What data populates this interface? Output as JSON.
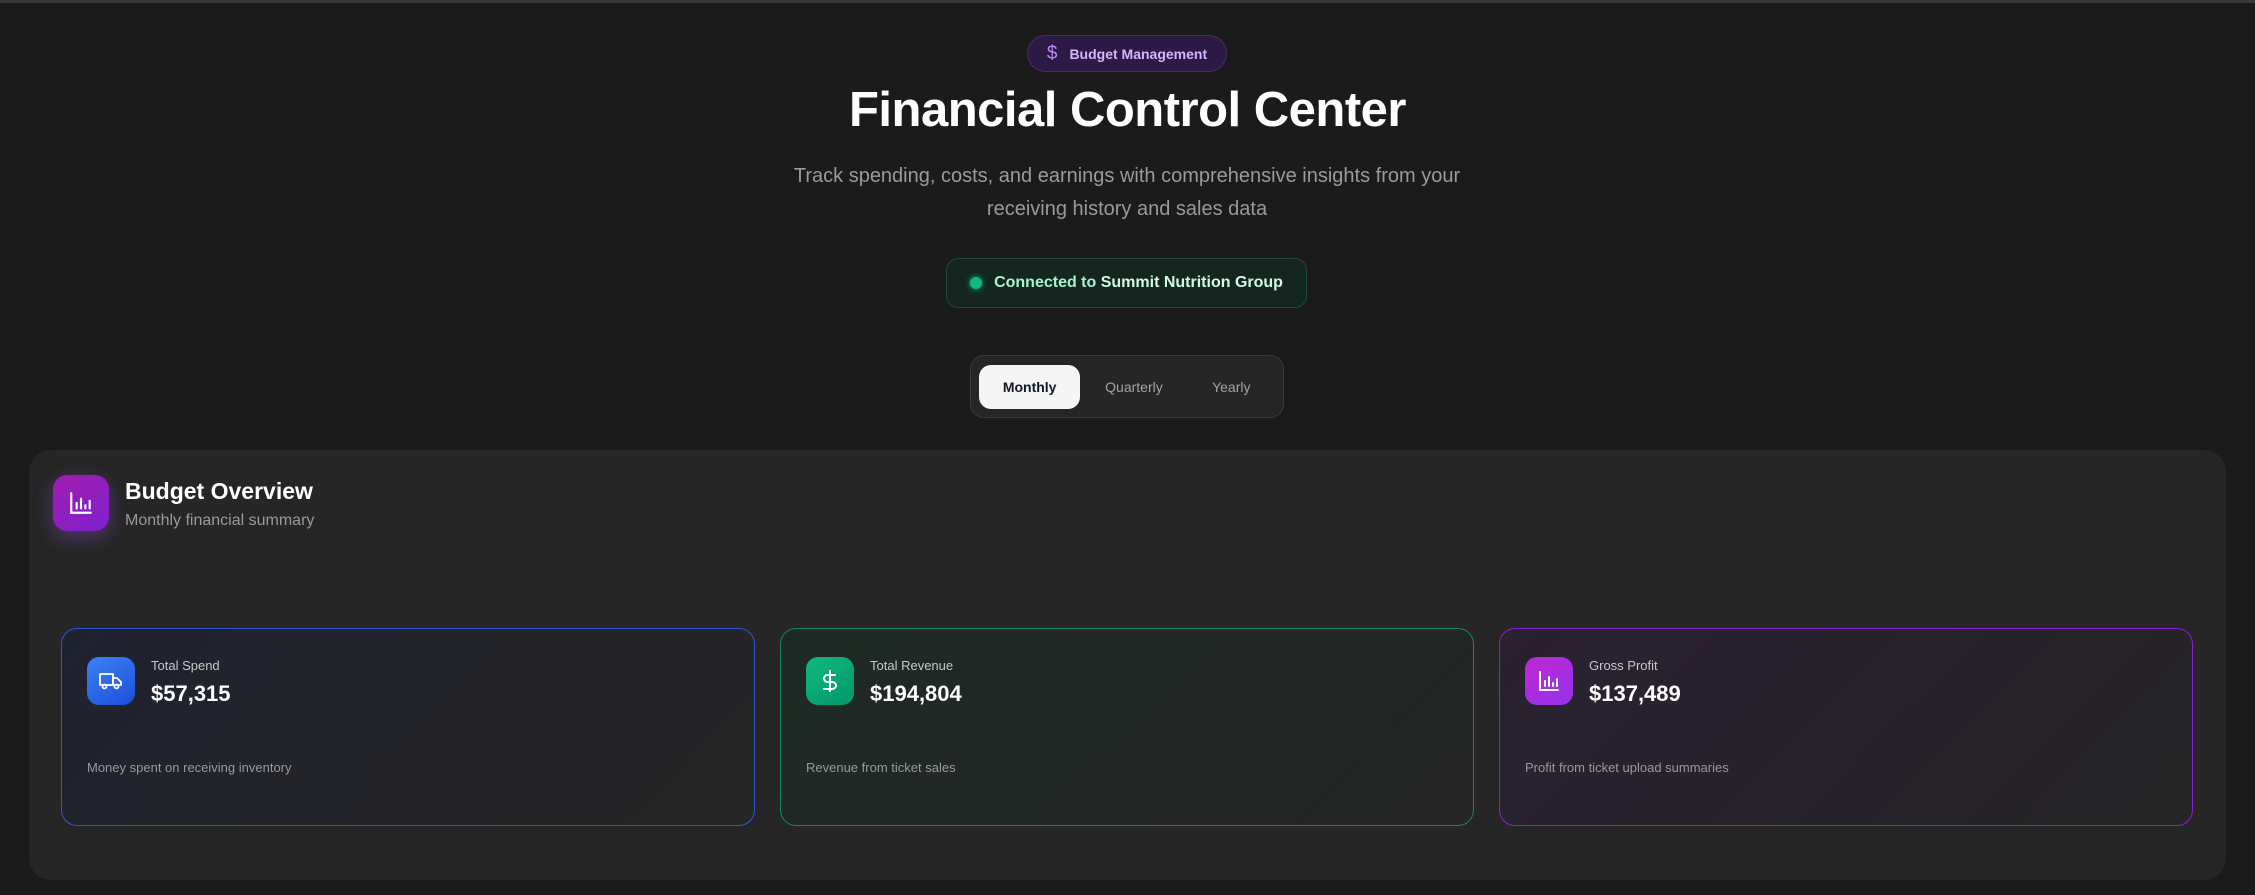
{
  "header": {
    "badge_label": "Budget Management",
    "title": "Financial Control Center",
    "subtitle": "Track spending, costs, and earnings with comprehensive insights from your receiving history and sales data"
  },
  "connection": {
    "prefix": "Connected to",
    "organization": "Summit Nutrition Group",
    "status_color": "#10b981"
  },
  "period_selector": {
    "options": [
      "Monthly",
      "Quarterly",
      "Yearly"
    ],
    "selected": "Monthly"
  },
  "overview": {
    "title": "Budget Overview",
    "subtitle": "Monthly financial summary",
    "icon": "bar-chart-icon",
    "cards": [
      {
        "label": "Total Spend",
        "value": "$57,315",
        "description": "Money spent on receiving inventory",
        "icon": "truck-icon",
        "accent": "#2f55d4"
      },
      {
        "label": "Total Revenue",
        "value": "$194,804",
        "description": "Revenue from ticket sales",
        "icon": "dollar-icon",
        "accent": "#15865c"
      },
      {
        "label": "Gross Profit",
        "value": "$137,489",
        "description": "Profit from ticket upload summaries",
        "icon": "bar-chart-icon",
        "accent": "#8b1fd3"
      }
    ]
  }
}
